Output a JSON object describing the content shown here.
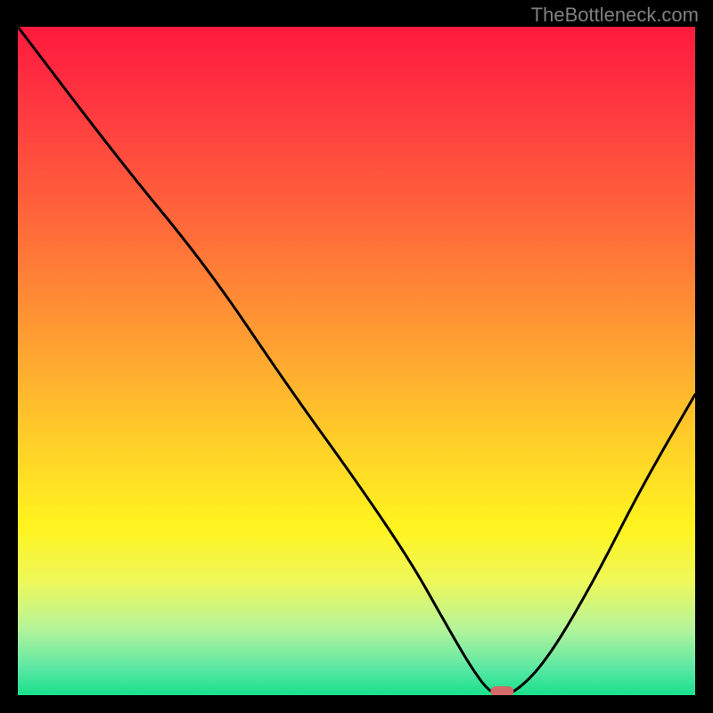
{
  "watermark": "TheBottleneck.com",
  "chart_data": {
    "type": "line",
    "title": "",
    "xlabel": "",
    "ylabel": "",
    "xlim": [
      0,
      100
    ],
    "ylim": [
      0,
      100
    ],
    "grid": false,
    "legend": false,
    "series": [
      {
        "name": "bottleneck-curve",
        "x": [
          0,
          15,
          28,
          40,
          50,
          58,
          63,
          67,
          70,
          73,
          78,
          85,
          92,
          100
        ],
        "values": [
          100,
          80,
          64,
          46,
          32,
          20,
          11,
          4,
          0,
          0,
          5,
          17,
          31,
          45
        ]
      }
    ],
    "marker": {
      "name": "optimal-point",
      "x": 71.5,
      "y": 0,
      "color": "#d46a6a"
    },
    "background_gradient": {
      "stops": [
        {
          "offset": 0.0,
          "color": "#ff1a3e"
        },
        {
          "offset": 0.12,
          "color": "#ff3840"
        },
        {
          "offset": 0.3,
          "color": "#ff6a3a"
        },
        {
          "offset": 0.48,
          "color": "#ffa231"
        },
        {
          "offset": 0.63,
          "color": "#ffd228"
        },
        {
          "offset": 0.75,
          "color": "#fff41f"
        },
        {
          "offset": 0.83,
          "color": "#eef85a"
        },
        {
          "offset": 0.9,
          "color": "#b6f49a"
        },
        {
          "offset": 0.96,
          "color": "#5ae8a4"
        },
        {
          "offset": 1.0,
          "color": "#18e08c"
        }
      ]
    },
    "colors": {
      "curve_stroke": "#000000",
      "frame_bg": "#000000",
      "marker_fill": "#d46a6a"
    }
  }
}
